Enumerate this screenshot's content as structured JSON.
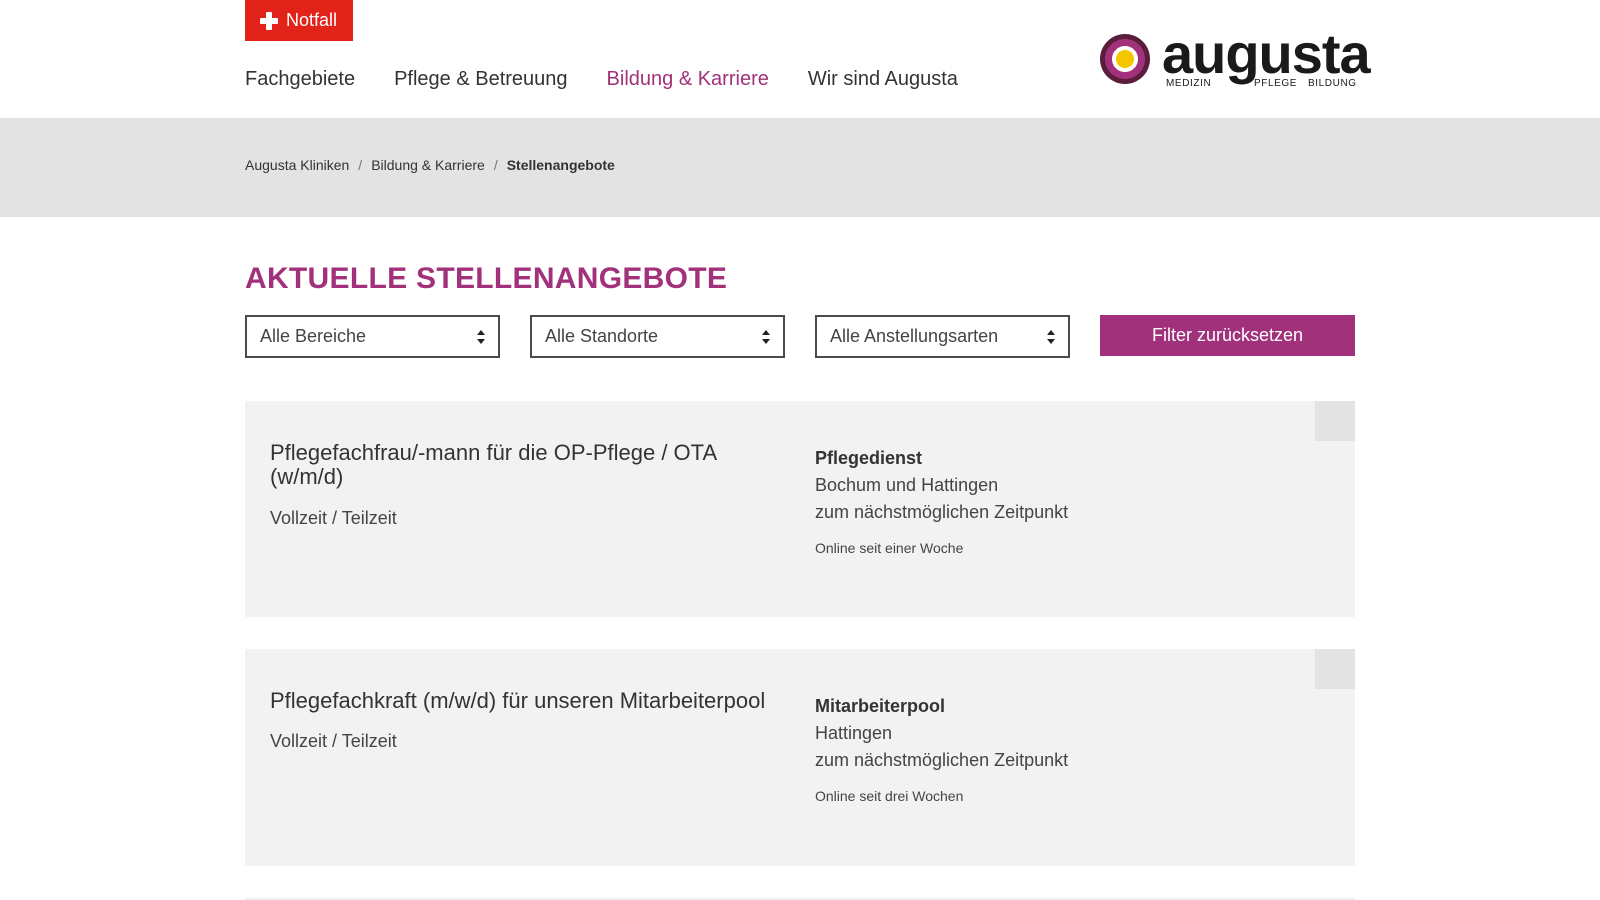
{
  "header": {
    "emergency_label": "Notfall",
    "nav": [
      {
        "label": "Fachgebiete",
        "active": false
      },
      {
        "label": "Pflege & Betreuung",
        "active": false
      },
      {
        "label": "Bildung & Karriere",
        "active": true
      },
      {
        "label": "Wir sind Augusta",
        "active": false
      }
    ],
    "logo": {
      "word": "augusta",
      "sub1": "MEDIZIN",
      "sub2": "PFLEGE",
      "sub3": "BILDUNG"
    }
  },
  "breadcrumb": {
    "items": [
      "Augusta Kliniken",
      "Bildung & Karriere",
      "Stellenangebote"
    ],
    "separator": "/"
  },
  "page_title": "AKTUELLE STELLENANGEBOTE",
  "filters": {
    "area": "Alle Bereiche",
    "location": "Alle Standorte",
    "employment": "Alle Anstellungsarten",
    "reset_label": "Filter zurücksetzen"
  },
  "jobs": [
    {
      "title": "Pflegefachfrau/-mann für die OP-Pflege / OTA (w/m/d)",
      "type": "Vollzeit / Teilzeit",
      "department": "Pflegedienst",
      "location": "Bochum und Hattingen",
      "start": "zum nächstmöglichen Zeitpunkt",
      "online": "Online seit einer Woche"
    },
    {
      "title": "Pflegefachkraft (m/w/d) für unseren Mitarbeiterpool",
      "type": "Vollzeit / Teilzeit",
      "department": "Mitarbeiterpool",
      "location": "Hattingen",
      "start": "zum nächstmöglichen Zeitpunkt",
      "online": "Online seit drei Wochen"
    }
  ],
  "colors": {
    "brand": "#a2317b",
    "emergency": "#e2231a",
    "breadcrumb_band": "#e3e3e3",
    "card_bg": "#f2f2f2"
  },
  "icons": {
    "emergency": "cross-icon",
    "select_arrows": "sort-arrows-icon"
  }
}
